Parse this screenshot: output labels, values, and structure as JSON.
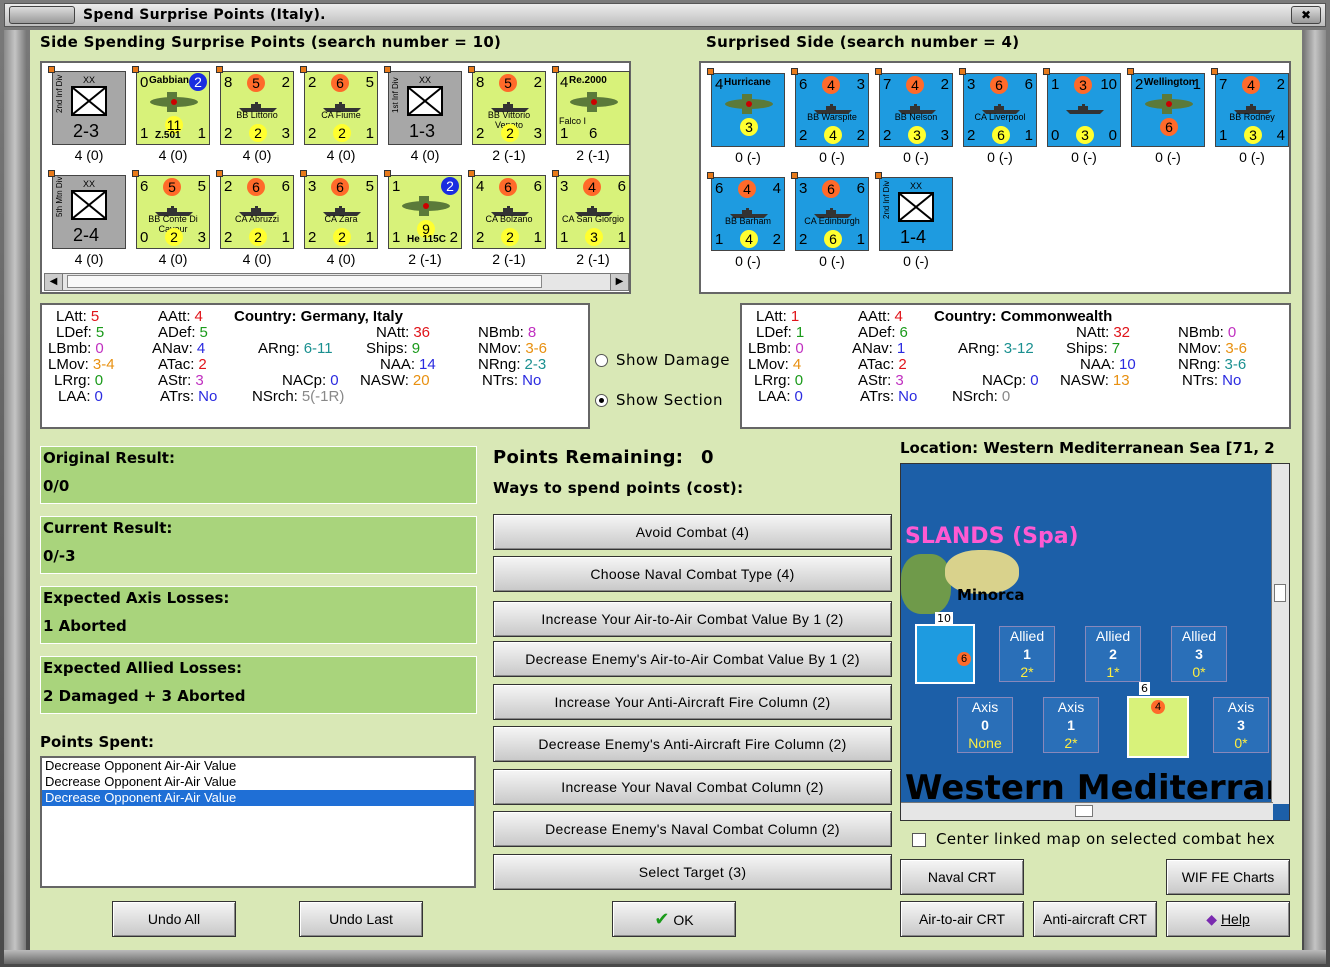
{
  "window": {
    "title": "Spend Surprise Points (Italy)."
  },
  "headers": {
    "side_spending": "Side Spending Surprise Points (search number = 10)",
    "surprised_side": "Surprised Side (search number = 4)"
  },
  "axis_units": [
    {
      "kind": "inf",
      "div": "2nd Inf Div",
      "val": "2-3",
      "label": "4 (0)"
    },
    {
      "kind": "air",
      "tl": "0",
      "name": "Gabbiano",
      "c1": "2",
      "c2": "11",
      "bl": "1",
      "pn": "Z.501",
      "br": "1",
      "label": "4 (0)"
    },
    {
      "kind": "ship",
      "tl": "8",
      "c": "5",
      "tr": "2",
      "name": "BB Littorio",
      "bl": "2",
      "bm": "2",
      "br": "3",
      "label": "4 (0)"
    },
    {
      "kind": "ship",
      "tl": "2",
      "c": "6",
      "tr": "5",
      "name": "CA Fiume",
      "bl": "2",
      "bm": "2",
      "br": "1",
      "label": "4 (0)"
    },
    {
      "kind": "inf",
      "div": "1st Inf Div",
      "val": "1-3",
      "label": "4 (0)"
    },
    {
      "kind": "ship",
      "tl": "8",
      "c": "5",
      "tr": "2",
      "name": "BB Vittorio Veneto",
      "bl": "2",
      "bm": "2",
      "br": "3",
      "label": "2 (-1)"
    },
    {
      "kind": "air2",
      "tl": "4",
      "name": "Re.2000",
      "sub": "Falco I",
      "bl": "1",
      "bm": "6",
      "label": "2 (-1)"
    },
    {
      "kind": "inf",
      "div": "5th Mtn Div",
      "val": "2-4",
      "label": "4 (0)"
    },
    {
      "kind": "ship",
      "tl": "6",
      "c": "5",
      "tr": "5",
      "name": "BB Conte Di Cavour",
      "bl": "0",
      "bm": "2",
      "br": "3",
      "label": "4 (0)"
    },
    {
      "kind": "ship",
      "tl": "2",
      "c": "6",
      "tr": "6",
      "name": "CA Abruzzi",
      "bl": "2",
      "bm": "2",
      "br": "1",
      "label": "4 (0)"
    },
    {
      "kind": "ship",
      "tl": "3",
      "c": "6",
      "tr": "5",
      "name": "CA Zara",
      "bl": "2",
      "bm": "2",
      "br": "1",
      "label": "4 (0)"
    },
    {
      "kind": "air3",
      "tl": "1",
      "c1": "2",
      "c2": "9",
      "bl": "1",
      "pn": "He 115C",
      "br": "2",
      "label": "2 (-1)"
    },
    {
      "kind": "ship",
      "tl": "4",
      "c": "6",
      "tr": "6",
      "name": "CA Bolzano",
      "bl": "2",
      "bm": "2",
      "br": "1",
      "label": "2 (-1)"
    },
    {
      "kind": "ship",
      "tl": "3",
      "c": "4",
      "tr": "6",
      "name": "CA San Giorgio",
      "bl": "1",
      "bm": "3",
      "br": "1",
      "label": "2 (-1)"
    }
  ],
  "allied_units": [
    {
      "kind": "air",
      "tl": "4",
      "name": "Hurricane",
      "c2": "3",
      "label": "0 (-)"
    },
    {
      "kind": "ship",
      "tl": "6",
      "c": "4",
      "tr": "3",
      "name": "BB Warspite",
      "bl": "2",
      "bm": "4",
      "br": "2",
      "label": "0 (-)"
    },
    {
      "kind": "ship",
      "tl": "7",
      "c": "4",
      "tr": "2",
      "name": "BB Nelson",
      "bl": "2",
      "bm": "3",
      "br": "3",
      "label": "0 (-)"
    },
    {
      "kind": "ship",
      "tl": "3",
      "c": "6",
      "tr": "6",
      "name": "CA Liverpool",
      "bl": "2",
      "bm": "6",
      "br": "1",
      "label": "0 (-)"
    },
    {
      "kind": "ship",
      "tl": "1",
      "c": "3",
      "tr": "10",
      "name": "",
      "bl": "0",
      "bm": "3",
      "br": "0",
      "label": "0 (-)"
    },
    {
      "kind": "air",
      "tl": "2",
      "name": "Wellington",
      "c2": "6",
      "tr": "1",
      "label": "0 (-)"
    },
    {
      "kind": "ship",
      "tl": "7",
      "c": "4",
      "tr": "2",
      "name": "BB Rodney",
      "bl": "1",
      "bm": "3",
      "br": "4",
      "label": "0 (-)"
    },
    {
      "kind": "ship",
      "tl": "6",
      "c": "4",
      "tr": "4",
      "name": "BB Barham",
      "bl": "1",
      "bm": "4",
      "br": "2",
      "label": "0 (-)"
    },
    {
      "kind": "ship",
      "tl": "3",
      "c": "6",
      "tr": "6",
      "name": "CA Edinburgh",
      "bl": "2",
      "bm": "6",
      "br": "1",
      "label": "0 (-)"
    },
    {
      "kind": "inf",
      "div": "2nd Inf Div",
      "val": "1-4",
      "label": "0 (-)"
    }
  ],
  "axis_stats": {
    "LAtt": "5",
    "LDef": "5",
    "LBmb": "0",
    "LMov": "3-4",
    "LRrg": "0",
    "LAA": "0",
    "AAtt": "4",
    "ADef": "5",
    "ANav": "4",
    "ATac": "2",
    "AStr": "3",
    "ATrs": "No",
    "country": "Country: Germany, Italy",
    "ARng": "6-11",
    "NACp": "0",
    "NSrch": "5(-1R)",
    "NAtt": "36",
    "Ships": "9",
    "NAA": "14",
    "NASW": "20",
    "NBmb": "8",
    "NMov": "3-6",
    "NRng": "2-3",
    "NTrs": "No"
  },
  "allied_stats": {
    "LAtt": "1",
    "LDef": "1",
    "LBmb": "0",
    "LMov": "4",
    "LRrg": "0",
    "LAA": "0",
    "AAtt": "4",
    "ADef": "6",
    "ANav": "1",
    "ATac": "2",
    "AStr": "3",
    "ATrs": "No",
    "country": "Country: Commonwealth",
    "ARng": "3-12",
    "NACp": "0",
    "NSrch": "0",
    "NAtt": "32",
    "Ships": "7",
    "NAA": "10",
    "NASW": "13",
    "NBmb": "0",
    "NMov": "3-6",
    "NRng": "3-6",
    "NTrs": "No"
  },
  "stat_labels": {
    "LAtt": "LAtt:",
    "LDef": "LDef:",
    "LBmb": "LBmb:",
    "LMov": "LMov:",
    "LRrg": "LRrg:",
    "LAA": "LAA:",
    "AAtt": "AAtt:",
    "ADef": "ADef:",
    "ANav": "ANav:",
    "ATac": "ATac:",
    "AStr": "AStr:",
    "ATrs": "ATrs:",
    "ARng": "ARng:",
    "NACp": "NACp:",
    "NSrch": "NSrch:",
    "NAtt": "NAtt:",
    "Ships": "Ships:",
    "NAA": "NAA:",
    "NASW": "NASW:",
    "NBmb": "NBmb:",
    "NMov": "NMov:",
    "NRng": "NRng:",
    "NTrs": "NTrs:"
  },
  "options": {
    "show_damage": "Show Damage",
    "show_section": "Show Section"
  },
  "results": {
    "original_label": "Original Result:",
    "original_value": "0/0",
    "current_label": "Current Result:",
    "current_value": "0/-3",
    "axis_losses_label": "Expected Axis Losses:",
    "axis_losses_value": "1 Aborted",
    "allied_losses_label": "Expected Allied Losses:",
    "allied_losses_value": "2 Damaged + 3 Aborted"
  },
  "points_spent": {
    "label": "Points Spent:",
    "items": [
      "Decrease Opponent Air-Air Value",
      "Decrease Opponent Air-Air Value",
      "Decrease Opponent Air-Air Value"
    ]
  },
  "spend": {
    "remaining_label": "Points Remaining:",
    "remaining_value": "0",
    "ways_label": "Ways to spend points (cost):",
    "options": [
      "Avoid Combat (4)",
      "Choose Naval Combat Type (4)",
      "Increase Your Air-to-Air Combat Value By 1 (2)",
      "Decrease Enemy's Air-to-Air Combat Value By 1 (2)",
      "Increase Your Anti-Aircraft Fire Column (2)",
      "Decrease Enemy's Anti-Aircraft Fire Column (2)",
      "Increase Your Naval Combat Column (2)",
      "Decrease Enemy's Naval Combat Column (2)",
      "Select Target (3)"
    ]
  },
  "buttons": {
    "undo_all": "Undo All",
    "undo_last": "Undo Last",
    "ok": "OK",
    "naval_crt": "Naval CRT",
    "wif_charts": "WIF FE Charts",
    "air_crt": "Air-to-air CRT",
    "aa_crt": "Anti-aircraft CRT",
    "help": "Help"
  },
  "map": {
    "location": "Location: Western Mediterranean Sea [71, 2",
    "islands": "SLANDS (Spa)",
    "minorca": "Minorca",
    "sea": "Western Mediterran",
    "hex_top_count": "10",
    "hex_ship_count": "6",
    "allied_boxes": [
      {
        "t": "Allied",
        "v": "1",
        "s": "2*"
      },
      {
        "t": "Allied",
        "v": "2",
        "s": "1*"
      },
      {
        "t": "Allied",
        "v": "3",
        "s": "0*"
      }
    ],
    "axis_boxes": [
      {
        "t": "Axis",
        "v": "0",
        "s": "None"
      },
      {
        "t": "Axis",
        "v": "1",
        "s": "2*"
      },
      {
        "t": "Axis",
        "v": "3",
        "s": "0*"
      }
    ],
    "center_linked": "Center linked map on selected combat hex"
  },
  "colors": {
    "axis_counter": "#d8f27a",
    "allied_counter": "#1e9be0",
    "panel_bg": "#d9e8b6",
    "result_bg": "#a9d47c"
  }
}
